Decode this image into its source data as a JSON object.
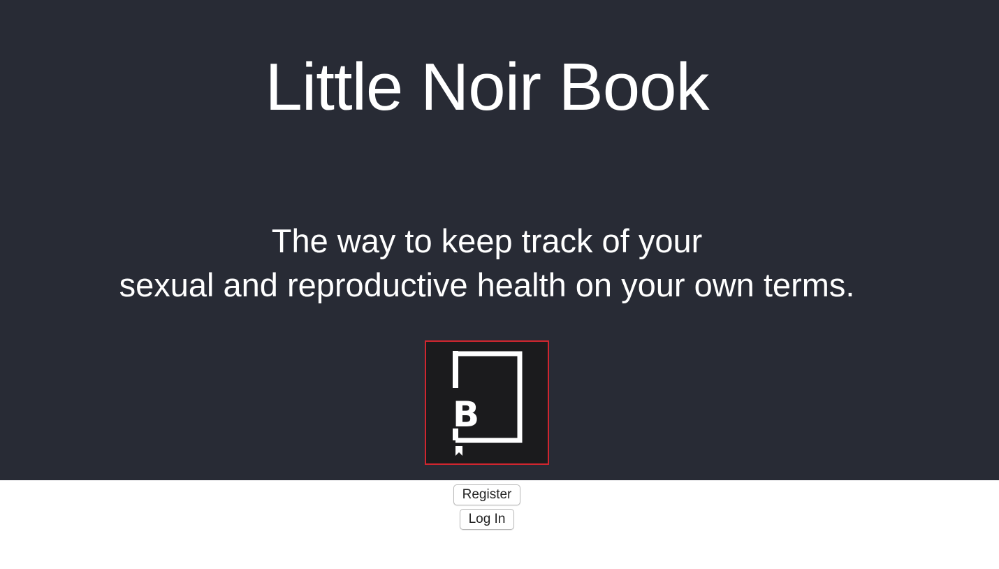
{
  "hero": {
    "title": "Little Noir Book",
    "tagline_line1": "The way to keep track of your",
    "tagline_line2": "sexual and reproductive health on your own terms.",
    "background_color": "#282b35",
    "text_color": "#ffffff"
  },
  "logo": {
    "icon": "book-bookmark-logo",
    "letter": "B",
    "background_color": "#1b1b1d",
    "border_color": "#d0262f"
  },
  "actions": {
    "register_label": "Register",
    "login_label": "Log In"
  }
}
